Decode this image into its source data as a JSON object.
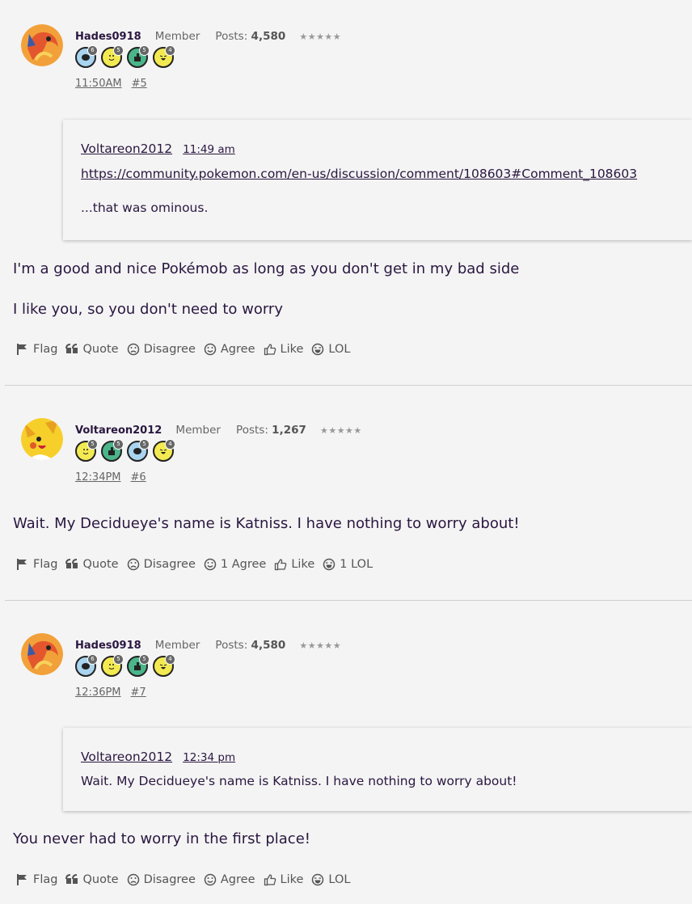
{
  "posts": [
    {
      "username": "Hades0918",
      "role": "Member",
      "posts_label": "Posts:",
      "posts_count": "4,580",
      "stars": "★★★★★",
      "badges": [
        {
          "icon": "comment-badge-icon",
          "color": "blue",
          "count": "6"
        },
        {
          "icon": "smile-badge-icon",
          "color": "yellow",
          "count": "5"
        },
        {
          "icon": "like-badge-icon",
          "color": "green",
          "count": "5"
        },
        {
          "icon": "laugh-badge-icon",
          "color": "yellow",
          "count": "4"
        }
      ],
      "time": "11:50AM",
      "number": "#5",
      "quote": {
        "author": "Voltareon2012",
        "time": "11:49 am",
        "link": "https://community.pokemon.com/en-us/discussion/comment/108603#Comment_108603",
        "text": "...that was ominous."
      },
      "body": [
        "I'm a good and nice Pokémob as long as you don't get in my bad side",
        "I like you, so you don't need to worry"
      ],
      "actions": {
        "flag": "Flag",
        "quote": "Quote",
        "disagree": "Disagree",
        "agree": "Agree",
        "like": "Like",
        "lol": "LOL"
      }
    },
    {
      "username": "Voltareon2012",
      "role": "Member",
      "posts_label": "Posts:",
      "posts_count": "1,267",
      "stars": "★★★★★",
      "badges": [
        {
          "icon": "smile-badge-icon",
          "color": "yellow",
          "count": "5"
        },
        {
          "icon": "like-badge-icon",
          "color": "green",
          "count": "5"
        },
        {
          "icon": "comment-badge-icon",
          "color": "blue",
          "count": "5"
        },
        {
          "icon": "laugh-badge-icon",
          "color": "yellow",
          "count": "4"
        }
      ],
      "time": "12:34PM",
      "number": "#6",
      "body": [
        "Wait. My Decidueye's name is Katniss. I have nothing to worry about!"
      ],
      "actions": {
        "flag": "Flag",
        "quote": "Quote",
        "disagree": "Disagree",
        "agree": "1 Agree",
        "like": "Like",
        "lol": "1 LOL"
      }
    },
    {
      "username": "Hades0918",
      "role": "Member",
      "posts_label": "Posts:",
      "posts_count": "4,580",
      "stars": "★★★★★",
      "badges": [
        {
          "icon": "comment-badge-icon",
          "color": "blue",
          "count": "6"
        },
        {
          "icon": "smile-badge-icon",
          "color": "yellow",
          "count": "5"
        },
        {
          "icon": "like-badge-icon",
          "color": "green",
          "count": "5"
        },
        {
          "icon": "laugh-badge-icon",
          "color": "yellow",
          "count": "4"
        }
      ],
      "time": "12:36PM",
      "number": "#7",
      "quote": {
        "author": "Voltareon2012",
        "time": "12:34 pm",
        "text": "Wait. My Decidueye's name is Katniss. I have nothing to worry about!"
      },
      "body": [
        "You never had to worry in the first place!"
      ],
      "actions": {
        "flag": "Flag",
        "quote": "Quote",
        "disagree": "Disagree",
        "agree": "Agree",
        "like": "Like",
        "lol": "LOL"
      }
    }
  ]
}
